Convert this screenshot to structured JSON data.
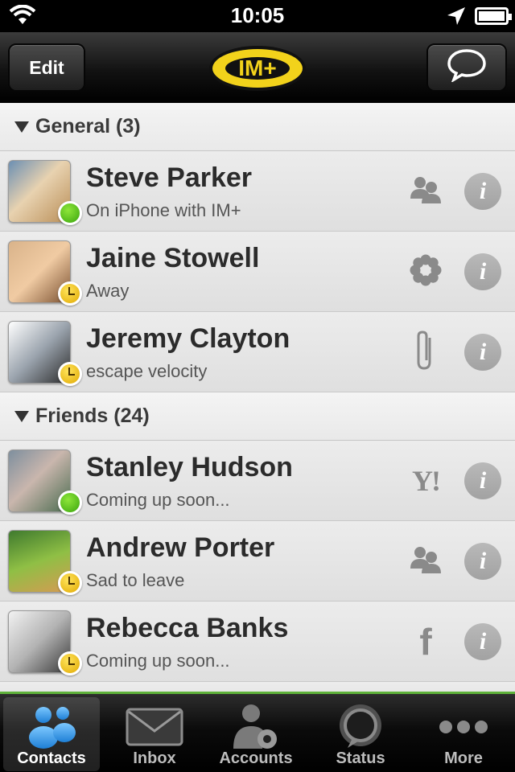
{
  "status_bar": {
    "time": "10:05"
  },
  "nav": {
    "edit_label": "Edit",
    "logo_text": "IM+",
    "chat_icon": "chat-bubble-icon"
  },
  "groups": [
    {
      "header": "General (3)",
      "contacts": [
        {
          "name": "Steve Parker",
          "status": "On iPhone with IM+",
          "presence": "online",
          "service": "group"
        },
        {
          "name": "Jaine Stowell",
          "status": "Away",
          "presence": "away",
          "service": "flower"
        },
        {
          "name": "Jeremy Clayton",
          "status": "escape velocity",
          "presence": "away",
          "service": "paperclip"
        }
      ]
    },
    {
      "header": "Friends (24)",
      "contacts": [
        {
          "name": "Stanley Hudson",
          "status": "Coming up soon...",
          "presence": "online",
          "service": "yahoo"
        },
        {
          "name": "Andrew Porter",
          "status": "Sad to leave",
          "presence": "away",
          "service": "group"
        },
        {
          "name": "Rebecca Banks",
          "status": "Coming up soon...",
          "presence": "away",
          "service": "facebook"
        }
      ]
    }
  ],
  "info_glyph": "i",
  "yahoo_glyph": "Y!",
  "facebook_glyph": "f",
  "tabs": [
    {
      "label": "Contacts",
      "icon": "contacts-icon",
      "active": true
    },
    {
      "label": "Inbox",
      "icon": "envelope-icon",
      "active": false
    },
    {
      "label": "Accounts",
      "icon": "accounts-gear-icon",
      "active": false
    },
    {
      "label": "Status",
      "icon": "speech-bubble-icon",
      "active": false
    },
    {
      "label": "More",
      "icon": "more-dots-icon",
      "active": false
    }
  ],
  "colors": {
    "accent_green": "#5fb33a",
    "logo_yellow": "#f2d21b",
    "online": "#3aa50e",
    "away": "#e0a800"
  }
}
